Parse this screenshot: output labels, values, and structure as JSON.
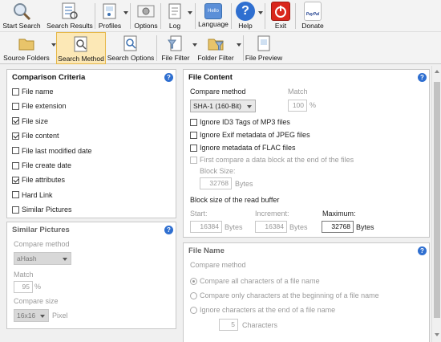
{
  "toolbar": {
    "start_search": "Start Search",
    "search_results": "Search Results",
    "profiles": "Profiles",
    "options": "Options",
    "log": "Log",
    "language": "Language",
    "language_icon_text": "Hello",
    "help": "Help",
    "exit": "Exit",
    "donate": "Donate",
    "donate_icon_text": "PayPal"
  },
  "toolbar2": {
    "source_folders": "Source Folders",
    "search_method": "Search Method",
    "search_options": "Search Options",
    "file_filter": "File Filter",
    "folder_filter": "Folder Filter",
    "file_preview": "File Preview"
  },
  "comparison": {
    "title": "Comparison Criteria",
    "items": [
      {
        "label": "File name",
        "checked": false
      },
      {
        "label": "File extension",
        "checked": false
      },
      {
        "label": "File size",
        "checked": true
      },
      {
        "label": "File content",
        "checked": true
      },
      {
        "label": "File last modified date",
        "checked": false
      },
      {
        "label": "File create date",
        "checked": false
      },
      {
        "label": "File attributes",
        "checked": true
      },
      {
        "label": "Hard Link",
        "checked": false
      },
      {
        "label": "Similar Pictures",
        "checked": false
      }
    ]
  },
  "similar": {
    "title": "Similar Pictures",
    "compare_method_label": "Compare method",
    "compare_method_value": "aHash",
    "match_label": "Match",
    "match_value": "95",
    "match_unit": "%",
    "compare_size_label": "Compare size",
    "compare_size_value": "16x16",
    "compare_size_unit": "Pixel"
  },
  "file_content": {
    "title": "File Content",
    "compare_method_label": "Compare method",
    "compare_method_value": "SHA-1 (160-Bit)",
    "match_label": "Match",
    "match_value": "100",
    "match_unit": "%",
    "options": [
      {
        "label": "Ignore ID3 Tags of MP3 files",
        "checked": false
      },
      {
        "label": "Ignore Exif metadata of JPEG files",
        "checked": false
      },
      {
        "label": "Ignore metadata of FLAC files",
        "checked": false
      }
    ],
    "first_compare_label": "First compare a data block at the end of the files",
    "block_size_label": "Block Size:",
    "block_size_value": "32768",
    "block_size_unit": "Bytes",
    "read_buffer_label": "Block size of the read buffer",
    "start_label": "Start:",
    "start_value": "16384",
    "start_unit": "Bytes",
    "increment_label": "Increment:",
    "increment_value": "16384",
    "increment_unit": "Bytes",
    "maximum_label": "Maximum:",
    "maximum_value": "32768",
    "maximum_unit": "Bytes"
  },
  "file_name": {
    "title": "File Name",
    "compare_method_label": "Compare method",
    "options": [
      {
        "label": "Compare all characters of a file name",
        "selected": true
      },
      {
        "label": "Compare only characters at the beginning of a file name",
        "selected": false
      },
      {
        "label": "Ignore characters at the end of a file name",
        "selected": false
      }
    ],
    "characters_value": "5",
    "characters_label": "Characters"
  },
  "help_glyph": "?"
}
